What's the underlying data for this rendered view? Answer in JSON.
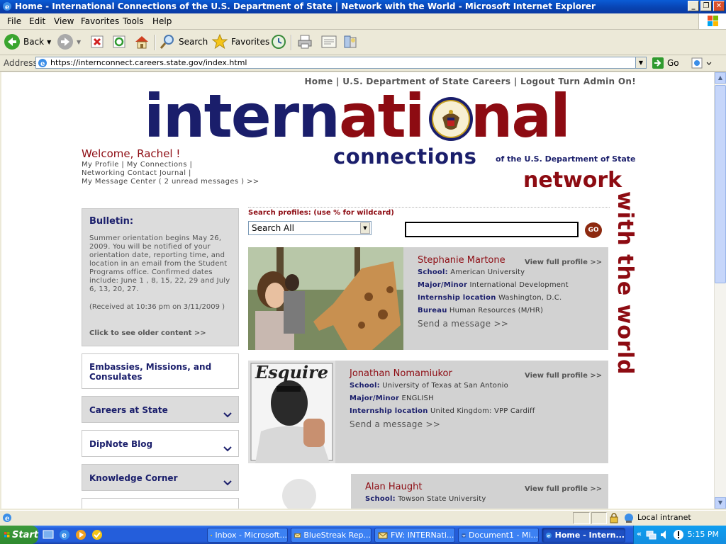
{
  "window": {
    "title": "Home - International Connections of the U.S. Department of State | Network with the World - Microsoft Internet Explorer",
    "minimize": "_",
    "restore": "❐",
    "close": "✕"
  },
  "menu": [
    "File",
    "Edit",
    "View",
    "Favorites",
    "Tools",
    "Help"
  ],
  "toolbar": {
    "back": "Back",
    "search": "Search",
    "favorites": "Favorites"
  },
  "address": {
    "label": "Address",
    "url": "https://internconnect.careers.state.gov/index.html",
    "go": "Go"
  },
  "topnav": {
    "home": "Home",
    "sep": " | ",
    "careers": "U.S. Department of State Careers",
    "logout": "Logout",
    "admin": "Turn Admin On!"
  },
  "logo": {
    "part1": "intern",
    "part2": "ati",
    "part3": "nal",
    "sub": "connections",
    "of": "of the U.S. Department of State",
    "network": "network",
    "with": "with the world"
  },
  "user": {
    "welcome": "Welcome, Rachel !",
    "profile": "My Profile",
    "connections": "My Connections",
    "journal": "Networking Contact Journal",
    "messages": "My Message Center ( 2 unread messages ) >>"
  },
  "bulletin": {
    "heading": "Bulletin:",
    "body": "Summer orientation begins May 26, 2009. You will be notified of your orientation date, reporting time, and location in an email from the Student Programs office. Confirmed dates include: June 1 , 8, 15, 22, 29 and July 6, 13, 20, 27.",
    "received": "(Received at 10:36 pm on 3/11/2009 )",
    "older": "Click to see older content >>"
  },
  "sidebar": [
    {
      "label": "Embassies, Missions, and Consulates"
    },
    {
      "label": "Careers at State"
    },
    {
      "label": "DipNote Blog"
    },
    {
      "label": "Knowledge Corner"
    }
  ],
  "search": {
    "label": "Search profiles: (use % for wildcard)",
    "scope": "Search All",
    "value": "",
    "go": "GO"
  },
  "profiles": [
    {
      "name": "Stephanie Martone",
      "view": "View full profile >>",
      "school_label": "School:",
      "school": "American University",
      "major_label": "Major/Minor",
      "major": "International Development",
      "location_label": "Internship location",
      "location": "Washington, D.C.",
      "bureau_label": "Bureau",
      "bureau": "Human Resources (M/HR)",
      "message": "Send a message >>"
    },
    {
      "name": "Jonathan Nomamiukor",
      "view": "View full profile >>",
      "school_label": "School:",
      "school": "University of Texas at San Antonio",
      "major_label": "Major/Minor",
      "major": "ENGLISH",
      "location_label": "Internship location",
      "location": "United Kingdom: VPP Cardiff",
      "message": "Send a message >>",
      "magazine": "Esquire"
    },
    {
      "name": "Alan Haught",
      "view": "View full profile >>",
      "school_label": "School:",
      "school": "Towson State University"
    }
  ],
  "status": {
    "zone": "Local intranet"
  },
  "taskbar": {
    "start": "Start",
    "tasks": [
      "Inbox - Microsoft...",
      "BlueStreak Rep...",
      "FW: INTERNati...",
      "Document1 - Mi...",
      "Home - Intern..."
    ],
    "clock": "5:15 PM"
  }
}
